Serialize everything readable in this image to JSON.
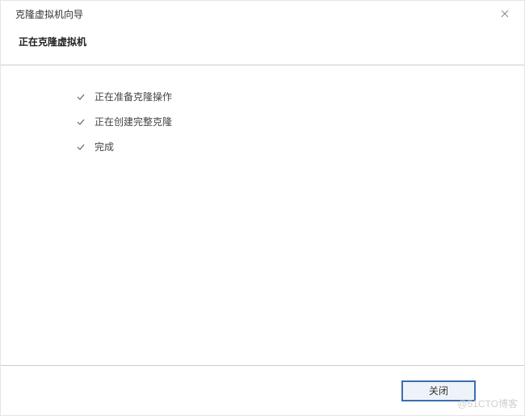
{
  "window": {
    "title": "克隆虚拟机向导",
    "subtitle": "正在克隆虚拟机"
  },
  "steps": [
    {
      "label": "正在准备克隆操作",
      "status": "done"
    },
    {
      "label": "正在创建完整克隆",
      "status": "done"
    },
    {
      "label": "完成",
      "status": "done"
    }
  ],
  "footer": {
    "close_label": "关闭"
  },
  "watermark": "@51CTO博客"
}
